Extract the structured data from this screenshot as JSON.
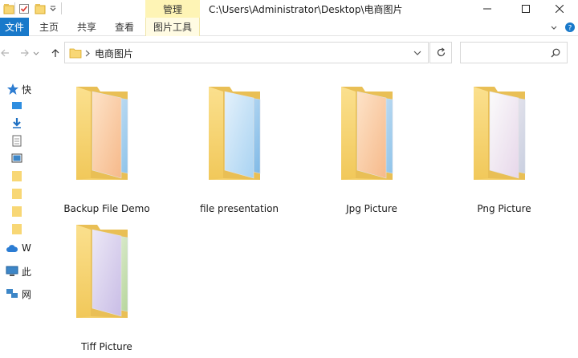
{
  "titlebar": {
    "manage_tab": "管理",
    "path": "C:\\Users\\Administrator\\Desktop\\电商图片"
  },
  "ribbon": {
    "file": "文件",
    "home": "主页",
    "share": "共享",
    "view": "查看",
    "picture_tools": "图片工具"
  },
  "address": {
    "current_folder": "电商图片",
    "search_placeholder": ""
  },
  "navpane": {
    "quick_access": "快",
    "item_onedrive": "W",
    "item_this_pc": "此",
    "item_network": "网"
  },
  "folders": [
    {
      "name": "Backup File Demo",
      "art": "warm"
    },
    {
      "name": "file presentation",
      "art": "cool"
    },
    {
      "name": "Jpg Picture",
      "art": "warm"
    },
    {
      "name": "Png Picture",
      "art": "blossom"
    },
    {
      "name": "Tiff Picture",
      "art": "lavender"
    }
  ],
  "colors": {
    "accent": "#1979ca",
    "manage_tab_bg": "#fef4b5",
    "folder_yellow": "#f8d775"
  }
}
